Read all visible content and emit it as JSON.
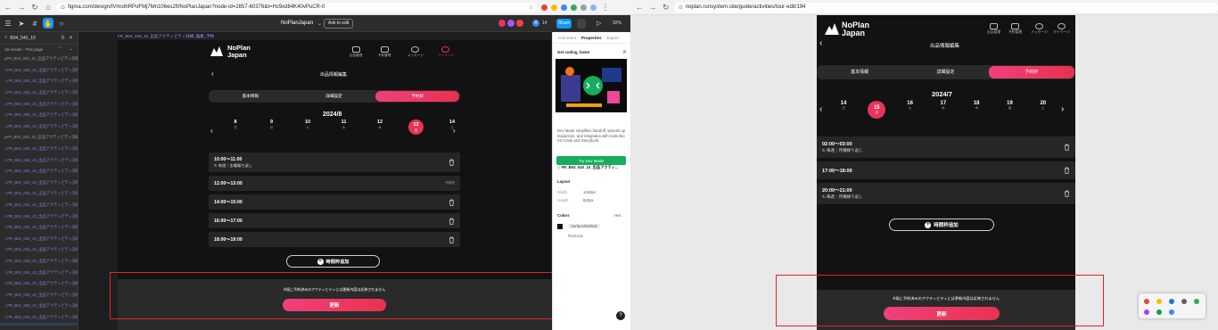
{
  "left_browser": {
    "url": "figma.com/design/tVmothRPoFMj7Mn106es2fl/NoPlanJapan?node-id=2857-60376&t=Hc9xd84K40vPuCR-0",
    "zoom": "92%",
    "file_title": "NoPlanJapan",
    "ask_label": "Ask to edit",
    "share_label": "Share",
    "avatar_count": "14",
    "avatar_letter": "A"
  },
  "layers": {
    "search_value": "B04_040_10",
    "results_text": "16 results · This page",
    "items": [
      {
        "label": "FR_B04_040_10_出品アクティビティ詳細_編集_予約",
        "kind": "parent"
      },
      {
        "label": "FR_B04_040_10_出品アクティビティ詳細_編集_予約",
        "kind": "child"
      },
      {
        "label": "FR_B04_040_10_出品アクティビティ詳細_編集_予約",
        "kind": "child"
      },
      {
        "label": "FR_B04_040_10_出品アクティビティ詳細_編集_予約",
        "kind": "child"
      },
      {
        "label": "FR_B04_040_10_出品アクティビティ詳細_編集_予約",
        "kind": "child"
      },
      {
        "label": "FR_B04_040_10_出品アクティビティ詳細_編集_予約",
        "kind": "child"
      },
      {
        "label": "FR_B04_040_10_出品アクティビティ詳細_編集_予約",
        "kind": "child"
      },
      {
        "label": "FR_B04_040_10_出品アクティビティ詳細_編集_予約",
        "kind": "parent"
      },
      {
        "label": "FR_B04_040_10_出品アクティビティ詳細_編集_予約",
        "kind": "child"
      },
      {
        "label": "FR_B04_040_10_出品アクティビティ詳細_編集_予約",
        "kind": "child"
      },
      {
        "label": "FR_B04_040_10_出品アクティビティ詳細_編集_予約",
        "kind": "child"
      },
      {
        "label": "FR_B04_040_10_出品アクティビティ詳細_編集_予約",
        "kind": "child"
      },
      {
        "label": "FR_B04_040_10_出品アクティビティ詳細_編集_予約",
        "kind": "child"
      },
      {
        "label": "FR_B04_040_10_出品アクティビティ詳細_編集_予約",
        "kind": "child"
      },
      {
        "label": "FR_B04_040_10_出品アクティビティ詳細_編集_予約",
        "kind": "child"
      },
      {
        "label": "FR_B04_040_10_出品アクティビティ詳細_編集_予約",
        "kind": "child"
      },
      {
        "label": "FR_B04_040_10_出品アクティビティ詳細_編集_予約",
        "kind": "child"
      },
      {
        "label": "FR_B04_040_10_出品アクティビティ詳細_編集_予約",
        "kind": "child"
      },
      {
        "label": "FR_B04_040_10_出品アクティビティ詳細_編集_予約",
        "kind": "child"
      },
      {
        "label": "FR_B04_040_10_出品アクティビティ詳細_編集_予約",
        "kind": "child"
      },
      {
        "label": "FR_B04_040_10_出品アクティビティ詳細_編集_予約",
        "kind": "child"
      },
      {
        "label": "FR_B04_040_10_出品アクティビティ詳細_編集_予約",
        "kind": "child"
      },
      {
        "label": "FR_B04_040_10_出品アクティビティ詳細_編集_予約",
        "kind": "child"
      },
      {
        "label": "FR_B04_040_10_出品アクティビティ詳細_編集_予約",
        "kind": "child"
      },
      {
        "label": "FR_B04_040_10_出品アクティビティ詳細_編集_予約",
        "kind": "child"
      },
      {
        "label": "FR_B04_040_10_出品アクティビティ詳細_編集_予約",
        "kind": "child"
      }
    ]
  },
  "frame_label": "FR_B04_040_10_出品アクティビティ詳細_編集_予約",
  "app": {
    "logo_line1": "NoPlan",
    "logo_line2": "Japan",
    "nav": [
      "出品管理",
      "予約管理",
      "メッセージ",
      "マイページ"
    ],
    "page_title": "出品情報編集",
    "tabs": [
      "基本情報",
      "詳細設定",
      "予約枠"
    ]
  },
  "design_screen": {
    "month": "2024/8",
    "dates": [
      {
        "num": "8",
        "dow": "日"
      },
      {
        "num": "9",
        "dow": "月"
      },
      {
        "num": "10",
        "dow": "火"
      },
      {
        "num": "11",
        "dow": "水"
      },
      {
        "num": "12",
        "dow": "木"
      },
      {
        "num": "13",
        "dow": "金",
        "selected": true
      },
      {
        "num": "14",
        "dow": "土"
      }
    ],
    "slots": [
      {
        "time": "10:00～11:00",
        "repeat": "毎週｜金曜繰り返し"
      },
      {
        "time": "12:00～13:00",
        "badge": "予約有"
      },
      {
        "time": "14:00～15:00"
      },
      {
        "time": "16:00～17:00"
      },
      {
        "time": "18:00～19:00"
      }
    ],
    "add_label": "時間枠追加",
    "notice": "※既に予約済みのアクティビティには更新内容は反映されません",
    "update_label": "更新"
  },
  "props_panel": {
    "tabs": [
      "Comment",
      "Properties",
      "Export"
    ],
    "card_title": "Get coding, faster",
    "card_desc": "Dev Mode simplifies handoff, speeds up inspection, and integrates with tools like VS Code and Storybook.",
    "card_button": "Try Dev Mode",
    "node_name": "FR_B04_040_10_出品アクティ...",
    "layout_label": "Layout",
    "width_label": "Width",
    "width_value": "1440px",
    "height_label": "Height",
    "height_value": "820px",
    "colors_label": "Colors",
    "colors_action": "Hex",
    "color_name": "Surface/Default",
    "color_hex": "#121212"
  },
  "right_browser": {
    "url": "noplan.runsystem.site/guide/activities/tour-edit/194"
  },
  "live_screen": {
    "month": "2024/7",
    "dates": [
      {
        "num": "14",
        "dow": "日"
      },
      {
        "num": "15",
        "dow": "月",
        "selected": true
      },
      {
        "num": "16",
        "dow": "火"
      },
      {
        "num": "17",
        "dow": "水"
      },
      {
        "num": "18",
        "dow": "木"
      },
      {
        "num": "19",
        "dow": "金"
      },
      {
        "num": "20",
        "dow": "土"
      }
    ],
    "slots": [
      {
        "time": "02:00～03:00",
        "repeat": "毎週｜月曜繰り返し"
      },
      {
        "time": "17:00～18:00"
      },
      {
        "time": "20:00～21:00",
        "repeat": "毎週｜月曜繰り返し"
      }
    ],
    "add_label": "時間枠追加",
    "notice": "※既に予約済みのアクティビティには更新内容は反映されません",
    "update_label": "更新"
  },
  "colors": {
    "accent": "#e8345a",
    "figma_blue": "#0d99ff",
    "dev_green": "#14ae5c",
    "surface": "#121212",
    "outline_red": "#e0242b"
  }
}
